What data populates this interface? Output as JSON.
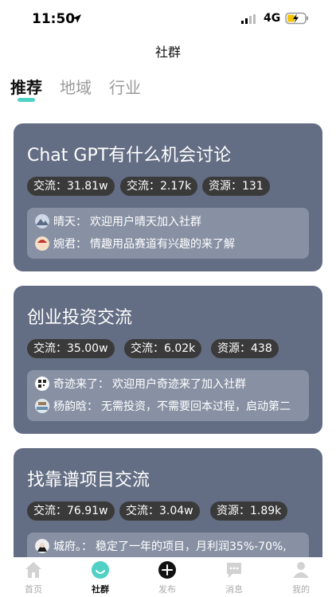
{
  "status_bar": {
    "time": "11:50",
    "network": "4G"
  },
  "header": {
    "title": "社群"
  },
  "tabs": [
    {
      "label": "推荐",
      "active": true
    },
    {
      "label": "地域",
      "active": false
    },
    {
      "label": "行业",
      "active": false
    }
  ],
  "cards": [
    {
      "title": "Chat GPT有什么机会讨论",
      "stats": [
        "交流：31.81w",
        "交流：2.17k",
        "资源：131"
      ],
      "messages": [
        {
          "avatar": "mountain-avatar",
          "name": "晴天：",
          "text": "欢迎用户晴天加入社群"
        },
        {
          "avatar": "cartoon-avatar",
          "name": "婉君：",
          "text": "情趣用品赛道有兴趣的来了解"
        }
      ]
    },
    {
      "title": "创业投资交流",
      "stats": [
        "交流：35.00w",
        "交流：6.02k",
        "资源：438"
      ],
      "messages": [
        {
          "avatar": "qr-avatar",
          "name": "奇迹来了：",
          "text": "欢迎用户奇迹来了加入社群"
        },
        {
          "avatar": "landscape-avatar",
          "name": "杨韵晗：",
          "text": "无需投资，不需要回本过程，启动第二"
        }
      ]
    },
    {
      "title": "找靠谱项目交流",
      "stats": [
        "交流：76.91w",
        "交流：3.04w",
        "资源：1.89k"
      ],
      "messages": [
        {
          "avatar": "portrait-avatar",
          "name": "城府。：",
          "text": "稳定了一年的项目，月利润35%-70%,"
        }
      ]
    }
  ],
  "bottom_nav": [
    {
      "label": "首页",
      "icon": "home-icon",
      "active": false
    },
    {
      "label": "社群",
      "icon": "community-icon",
      "active": true
    },
    {
      "label": "发布",
      "icon": "publish-plus-icon",
      "active": false
    },
    {
      "label": "消息",
      "icon": "message-icon",
      "active": false
    },
    {
      "label": "我的",
      "icon": "profile-icon",
      "active": false
    }
  ],
  "colors": {
    "accent": "#4fd1c5",
    "card_bg": "#636d83",
    "stat_pill": "#3a3a3a",
    "message_box": "#8891a4"
  }
}
